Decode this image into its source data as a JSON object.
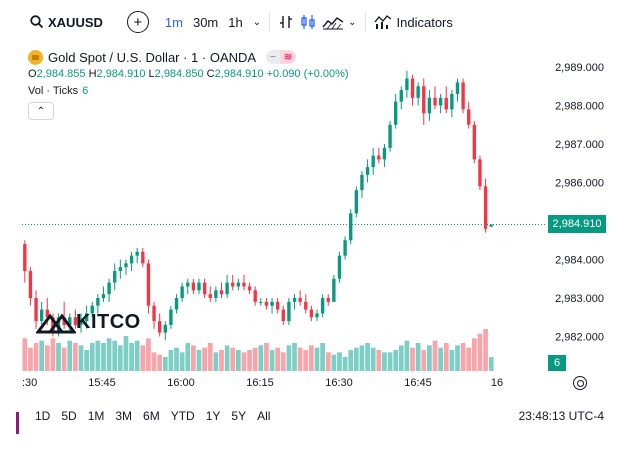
{
  "toolbar": {
    "symbol": "XAUUSD",
    "timeframes": [
      "1m",
      "30m",
      "1h"
    ],
    "active_timeframe": "1m",
    "indicators_label": "Indicators",
    "icons": [
      "search-icon",
      "add-compare-icon",
      "chevron-down-icon",
      "bar-style-icon",
      "candle-style-icon",
      "area-style-icon",
      "indicators-icon"
    ]
  },
  "legend": {
    "title": "Gold Spot / U.S. Dollar · 1 · OANDA",
    "pill_left": "−",
    "pill_right": "≋",
    "ohlc": {
      "o_label": "O",
      "o": "2,984.855",
      "h_label": "H",
      "h": "2,984.910",
      "l_label": "L",
      "l": "2,984.850",
      "c_label": "C",
      "c": "2,984.910",
      "change": "+0.090 (+0.00%)"
    },
    "volume_label": "Vol · Ticks",
    "volume_value": "6",
    "collapse_glyph": "⌃"
  },
  "price_axis": {
    "ticks": [
      "2,989.000",
      "2,988.000",
      "2,987.000",
      "2,986.000",
      "2,984.000",
      "2,983.000",
      "2,982.000"
    ],
    "last_price": "2,984.910",
    "last_volume": "6"
  },
  "time_axis": {
    "ticks": [
      ":30",
      "15:45",
      "16:00",
      "16:15",
      "16:30",
      "16:45",
      "16"
    ]
  },
  "watermark": {
    "text": "KITCO"
  },
  "bottom_bar": {
    "ranges": [
      "1D",
      "5D",
      "1M",
      "3M",
      "6M",
      "YTD",
      "1Y",
      "5Y",
      "All"
    ],
    "clock": "23:48:13 UTC-4"
  },
  "colors": {
    "up": "#089981",
    "down": "#f23645",
    "up_volume": "#7ccfc4",
    "down_volume": "#f7a4aa",
    "accent": "#2962ff"
  },
  "chart_data": {
    "type": "candlestick",
    "ylim": [
      2981.3,
      2989.3
    ],
    "price_ticks": [
      2989,
      2988,
      2987,
      2986,
      2984,
      2983,
      2982
    ],
    "last_price": 2984.91,
    "candles_ohlc": [
      [
        2984.4,
        2984.5,
        2983.4,
        2983.7
      ],
      [
        2983.7,
        2983.8,
        2982.8,
        2983.0
      ],
      [
        2983.0,
        2983.2,
        2982.2,
        2982.4
      ],
      [
        2982.4,
        2982.9,
        2982.3,
        2982.7
      ],
      [
        2982.7,
        2983.0,
        2982.3,
        2982.5
      ],
      [
        2982.5,
        2982.6,
        2982.0,
        2982.1
      ],
      [
        2982.1,
        2982.6,
        2982.0,
        2982.5
      ],
      [
        2982.5,
        2982.9,
        2982.2,
        2982.3
      ],
      [
        2982.3,
        2982.6,
        2982.1,
        2982.5
      ],
      [
        2982.5,
        2982.7,
        2982.2,
        2982.3
      ],
      [
        2982.3,
        2982.6,
        2982.1,
        2982.4
      ],
      [
        2982.4,
        2982.8,
        2982.2,
        2982.6
      ],
      [
        2982.6,
        2982.9,
        2982.5,
        2982.8
      ],
      [
        2982.8,
        2983.1,
        2982.6,
        2983.0
      ],
      [
        2983.0,
        2983.3,
        2982.9,
        2983.1
      ],
      [
        2983.1,
        2983.5,
        2982.9,
        2983.4
      ],
      [
        2983.4,
        2983.9,
        2983.2,
        2983.7
      ],
      [
        2983.7,
        2984.0,
        2983.5,
        2983.8
      ],
      [
        2983.8,
        2984.0,
        2983.6,
        2983.9
      ],
      [
        2983.9,
        2984.2,
        2983.7,
        2984.1
      ],
      [
        2984.1,
        2984.3,
        2983.9,
        2984.2
      ],
      [
        2984.2,
        2984.3,
        2983.8,
        2983.9
      ],
      [
        2983.9,
        2984.0,
        2982.6,
        2982.8
      ],
      [
        2982.8,
        2982.9,
        2982.2,
        2982.4
      ],
      [
        2982.4,
        2982.6,
        2982.0,
        2982.1
      ],
      [
        2982.1,
        2982.4,
        2981.9,
        2982.3
      ],
      [
        2982.3,
        2982.8,
        2982.2,
        2982.7
      ],
      [
        2982.7,
        2983.1,
        2982.6,
        2983.0
      ],
      [
        2983.0,
        2983.4,
        2982.9,
        2983.3
      ],
      [
        2983.3,
        2983.5,
        2983.1,
        2983.4
      ],
      [
        2983.4,
        2983.5,
        2983.1,
        2983.2
      ],
      [
        2983.2,
        2983.5,
        2983.1,
        2983.4
      ],
      [
        2983.4,
        2983.5,
        2983.0,
        2983.1
      ],
      [
        2983.1,
        2983.3,
        2982.9,
        2983.0
      ],
      [
        2983.0,
        2983.3,
        2982.9,
        2983.2
      ],
      [
        2983.2,
        2983.4,
        2983.0,
        2983.1
      ],
      [
        2983.1,
        2983.6,
        2983.0,
        2983.4
      ],
      [
        2983.4,
        2983.6,
        2983.2,
        2983.3
      ],
      [
        2983.3,
        2983.5,
        2983.2,
        2983.4
      ],
      [
        2983.4,
        2983.6,
        2983.2,
        2983.3
      ],
      [
        2983.3,
        2983.4,
        2983.1,
        2983.2
      ],
      [
        2983.2,
        2983.3,
        2982.8,
        2982.9
      ],
      [
        2982.9,
        2983.0,
        2982.8,
        2982.9
      ],
      [
        2982.9,
        2983.0,
        2982.7,
        2982.8
      ],
      [
        2982.8,
        2983.0,
        2982.6,
        2982.9
      ],
      [
        2982.9,
        2983.0,
        2982.6,
        2982.7
      ],
      [
        2982.7,
        2982.8,
        2982.3,
        2982.4
      ],
      [
        2982.4,
        2983.0,
        2982.3,
        2982.9
      ],
      [
        2982.9,
        2983.1,
        2982.7,
        2983.0
      ],
      [
        2983.0,
        2983.2,
        2982.8,
        2982.9
      ],
      [
        2982.9,
        2983.1,
        2982.6,
        2982.7
      ],
      [
        2982.7,
        2982.8,
        2982.4,
        2982.5
      ],
      [
        2982.5,
        2982.7,
        2982.4,
        2982.6
      ],
      [
        2982.6,
        2983.1,
        2982.5,
        2983.0
      ],
      [
        2983.0,
        2983.1,
        2982.8,
        2982.9
      ],
      [
        2982.9,
        2983.6,
        2982.9,
        2983.5
      ],
      [
        2983.5,
        2984.2,
        2983.4,
        2984.1
      ],
      [
        2984.1,
        2984.6,
        2984.0,
        2984.5
      ],
      [
        2984.5,
        2985.3,
        2984.4,
        2985.2
      ],
      [
        2985.2,
        2985.9,
        2985.1,
        2985.8
      ],
      [
        2985.8,
        2986.3,
        2985.6,
        2986.2
      ],
      [
        2986.2,
        2986.6,
        2986.0,
        2986.4
      ],
      [
        2986.4,
        2986.9,
        2986.2,
        2986.7
      ],
      [
        2986.7,
        2986.9,
        2986.5,
        2986.6
      ],
      [
        2986.6,
        2987.0,
        2986.4,
        2986.9
      ],
      [
        2986.9,
        2987.6,
        2986.8,
        2987.5
      ],
      [
        2987.5,
        2988.3,
        2987.4,
        2988.1
      ],
      [
        2988.1,
        2988.5,
        2987.9,
        2988.4
      ],
      [
        2988.4,
        2988.9,
        2988.2,
        2988.7
      ],
      [
        2988.7,
        2988.8,
        2988.0,
        2988.2
      ],
      [
        2988.2,
        2988.6,
        2988.0,
        2988.5
      ],
      [
        2988.5,
        2988.7,
        2987.5,
        2987.8
      ],
      [
        2987.8,
        2988.4,
        2987.6,
        2988.2
      ],
      [
        2988.2,
        2988.5,
        2987.9,
        2988.0
      ],
      [
        2988.0,
        2988.3,
        2987.8,
        2988.2
      ],
      [
        2988.2,
        2988.5,
        2987.8,
        2987.9
      ],
      [
        2987.9,
        2988.4,
        2987.7,
        2988.3
      ],
      [
        2988.3,
        2988.7,
        2988.1,
        2988.6
      ],
      [
        2988.6,
        2988.7,
        2987.8,
        2987.9
      ],
      [
        2987.9,
        2988.1,
        2987.4,
        2987.5
      ],
      [
        2987.5,
        2987.6,
        2986.5,
        2986.6
      ],
      [
        2986.6,
        2986.7,
        2985.8,
        2985.9
      ],
      [
        2985.9,
        2986.1,
        2984.7,
        2984.8
      ],
      [
        2984.85,
        2984.91,
        2984.85,
        2984.91
      ]
    ],
    "volume_ticks": [
      14,
      10,
      12,
      13,
      11,
      14,
      12,
      10,
      13,
      12,
      11,
      9,
      12,
      13,
      12,
      14,
      13,
      11,
      15,
      12,
      13,
      11,
      14,
      8,
      7,
      6,
      9,
      10,
      8,
      12,
      11,
      9,
      10,
      12,
      8,
      9,
      11,
      10,
      9,
      8,
      9,
      10,
      11,
      12,
      9,
      10,
      8,
      11,
      12,
      10,
      9,
      11,
      10,
      12,
      8,
      7,
      8,
      6,
      9,
      10,
      11,
      12,
      10,
      9,
      8,
      8,
      9,
      11,
      13,
      10,
      12,
      9,
      11,
      13,
      10,
      12,
      9,
      11,
      12,
      10,
      14,
      16,
      18,
      6
    ]
  }
}
